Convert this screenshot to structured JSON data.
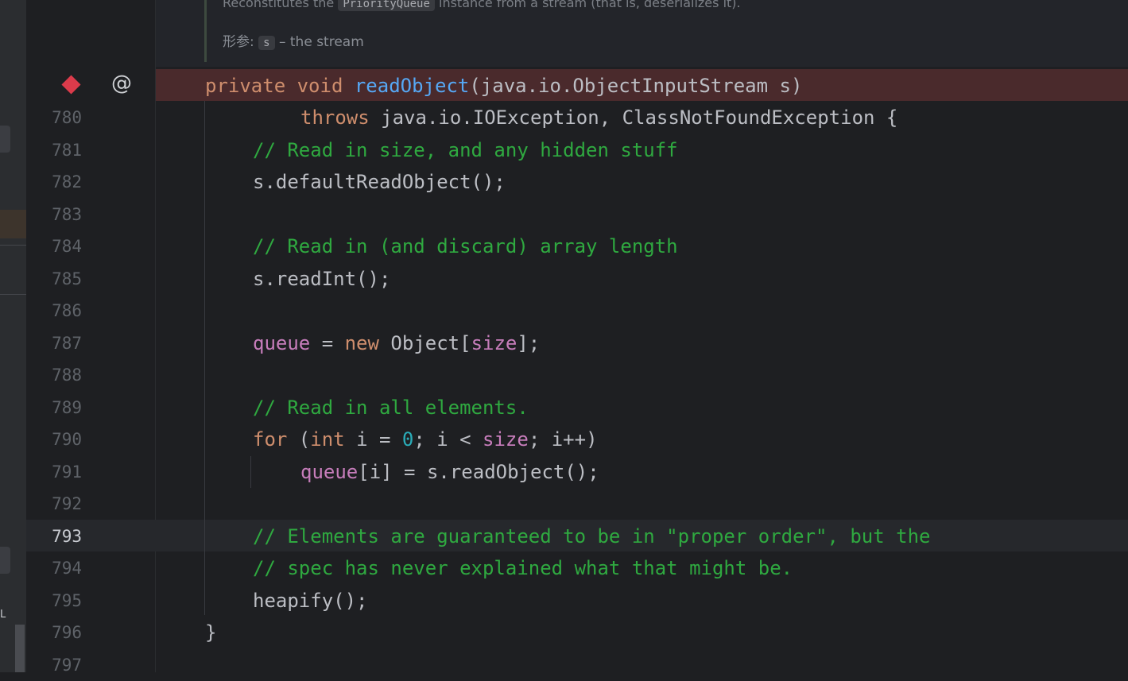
{
  "doc": {
    "summary_pre": "Reconstitutes the ",
    "summary_code": "PriorityQueue",
    "summary_post": " instance from a stream (that is, deserializes it).",
    "param_label": "形参:",
    "param_name": "s",
    "param_desc": "– the stream"
  },
  "gutter": {
    "breakpoint_icon": "breakpoint-diamond-icon",
    "override_icon": "at-sign-icon",
    "at_symbol": "@",
    "current_line": "793"
  },
  "code": {
    "line_numbers": [
      "780",
      "781",
      "782",
      "783",
      "784",
      "785",
      "786",
      "787",
      "788",
      "789",
      "790",
      "791",
      "792",
      "793",
      "794",
      "795",
      "796",
      "797"
    ],
    "sig_kw1": "private",
    "sig_kw2": "void",
    "sig_fn": "readObject",
    "sig_rest": "(java.io.ObjectInputStream s)",
    "throws_kw": "throws",
    "throws_rest": " java.io.IOException, ClassNotFoundException {",
    "c781": "// Read in size, and any hidden stuff",
    "l782": "s.defaultReadObject();",
    "c784": "// Read in (and discard) array length",
    "l785": "s.readInt();",
    "l787_field": "queue",
    "l787_eq": " = ",
    "l787_new": "new",
    "l787_obj": " Object[",
    "l787_size": "size",
    "l787_end": "];",
    "c789": "// Read in all elements.",
    "l790_for": "for",
    "l790_p": " (",
    "l790_int": "int",
    "l790_mid": " i = ",
    "l790_zero": "0",
    "l790_mid2": "; i < ",
    "l790_size": "size",
    "l790_end": "; i++)",
    "l791_field": "queue",
    "l791_rest": "[i] = s.readObject();",
    "c793": "// Elements are guaranteed to be in \"proper order\", but the",
    "c794": "// spec has never explained what that might be.",
    "l795": "heapify();",
    "l796": "}"
  },
  "colors": {
    "keyword": "#cf8e6d",
    "function": "#56a8f5",
    "comment": "#2fa940",
    "field": "#c77dbb",
    "number": "#2aacb8",
    "breakpoint": "#db3b4b"
  }
}
